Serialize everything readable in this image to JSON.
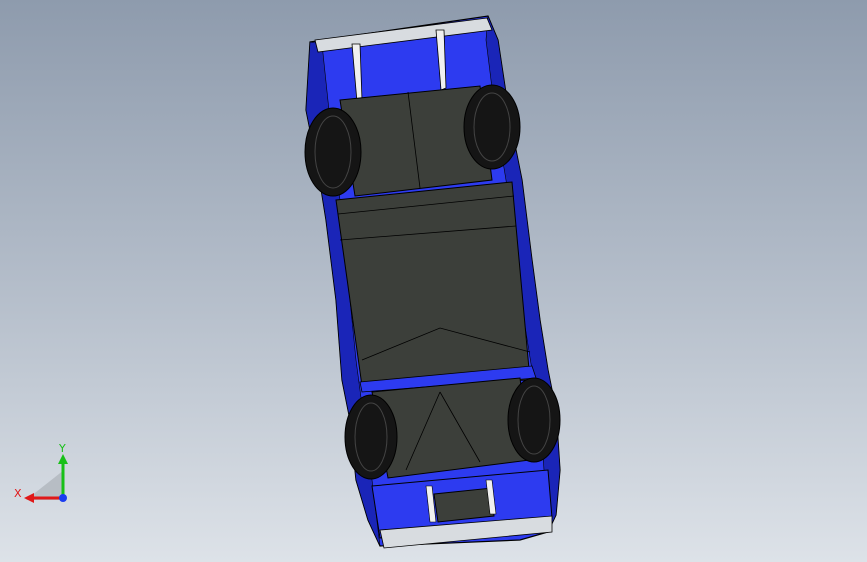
{
  "scene": {
    "background_top": "#8e9bad",
    "background_bottom": "#dde2e8",
    "body_color": "#2d3bf0",
    "body_shade": "#1a25b8",
    "undertray_color": "#3c3f3a",
    "tire_color": "#151515",
    "edge_color": "#000000"
  },
  "triad": {
    "x_label": "X",
    "y_label": "Y",
    "x_color": "#e01818",
    "y_color": "#18c018",
    "z_color": "#1a3cf0"
  }
}
